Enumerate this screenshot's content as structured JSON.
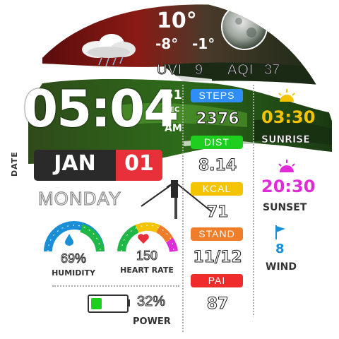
{
  "weather": {
    "temp": "10°",
    "low": "-8°",
    "high": "-1°",
    "uvi_label": "UVI",
    "uvi_value": "9",
    "aqi_label": "AQI",
    "aqi_value": "37",
    "icon": "rain-cloud-icon"
  },
  "time": {
    "hours_minutes": "05:04",
    "seconds": "51",
    "sec_label": "SEC",
    "ampm": "AM"
  },
  "date": {
    "label": "DATE",
    "month": "JAN",
    "day": "01",
    "weekday": "MONDAY"
  },
  "gauges": {
    "humidity": {
      "value": "69%",
      "label": "HUMIDITY",
      "level": 0.69
    },
    "heart_rate": {
      "value": "150",
      "label": "HEART RATE",
      "level": 0.75
    }
  },
  "power": {
    "value": "32%",
    "label": "POWER",
    "level": 0.32
  },
  "metrics": [
    {
      "label": "STEPS",
      "value": "2376",
      "color": "#2f8ef5"
    },
    {
      "label": "DIST",
      "value": "8.14",
      "color": "#1fcf1f"
    },
    {
      "label": "KCAL",
      "value": "71",
      "color": "#f5c400"
    },
    {
      "label": "STAND",
      "value": "11/12",
      "color": "#ef7d2a"
    },
    {
      "label": "PAI",
      "value": "87",
      "color": "#ef2b2b"
    }
  ],
  "sun": {
    "sunrise_time": "03:30",
    "sunrise_label": "SUNRISE",
    "sunset_time": "20:30",
    "sunset_label": "SUNSET"
  },
  "wind": {
    "value": "8",
    "label": "WIND"
  },
  "colors": {
    "sunrise": "#f5c400",
    "sunset": "#e02bd8",
    "wind": "#1a8fd8",
    "date_day_bg": "#e8303a",
    "date_month_bg": "#2a2a2a"
  }
}
